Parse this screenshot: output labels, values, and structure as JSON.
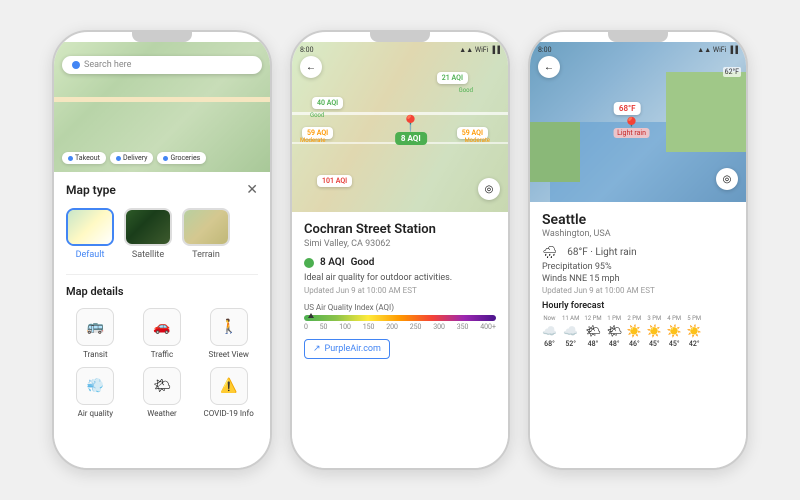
{
  "phones": [
    {
      "id": "phone1",
      "statusbar": {
        "time": "",
        "signal": ""
      },
      "map": {
        "search_placeholder": "Search here"
      },
      "chips": [
        "Takeout",
        "Delivery",
        "Groceries"
      ],
      "panel": {
        "title": "Map type",
        "types": [
          {
            "id": "default",
            "label": "Default",
            "active": true
          },
          {
            "id": "satellite",
            "label": "Satellite",
            "active": false
          },
          {
            "id": "terrain",
            "label": "Terrain",
            "active": false
          }
        ],
        "details_title": "Map details",
        "details": [
          {
            "id": "transit",
            "label": "Transit",
            "icon": "🚌"
          },
          {
            "id": "traffic",
            "label": "Traffic",
            "icon": "🚗"
          },
          {
            "id": "street_view",
            "label": "Street View",
            "icon": "🚶"
          },
          {
            "id": "air_quality",
            "label": "Air quality",
            "icon": "💨"
          },
          {
            "id": "weather",
            "label": "Weather",
            "icon": "🌤"
          },
          {
            "id": "covid",
            "label": "COVID-19 Info",
            "icon": "⚠️"
          }
        ]
      }
    },
    {
      "id": "phone2",
      "statusbar": {
        "time": "8:00"
      },
      "aqi_badges": [
        {
          "value": "21 AQI",
          "class": "aqi-21",
          "label": "Good"
        },
        {
          "value": "40 AQI",
          "class": "aqi-40",
          "label": "Good"
        },
        {
          "value": "59 AQI",
          "class": "aqi-59a",
          "label": "Moderate"
        },
        {
          "value": "59 AQI",
          "class": "aqi-59b",
          "label": "Moderate"
        },
        {
          "value": "101 AQI",
          "class": "aqi-101",
          "label": ""
        }
      ],
      "location": {
        "name": "Cochran Street Station",
        "address": "Simi Valley, CA 93062",
        "aqi_value": "8 AQI",
        "aqi_quality": "Good",
        "description": "Ideal air quality for outdoor activities.",
        "updated": "Updated Jun 9 at 10:00 AM EST",
        "bar_title": "US Air Quality Index (AQI)",
        "bar_numbers": [
          "0",
          "50",
          "100",
          "150",
          "200",
          "250",
          "300",
          "350",
          "400+"
        ],
        "source_link": "PurpleAir.com"
      }
    },
    {
      "id": "phone3",
      "statusbar": {
        "time": "8:00"
      },
      "temp_labels": [
        "62°F",
        ""
      ],
      "weather_badge": "68°F",
      "location": {
        "city": "Seattle",
        "state": "Washington, USA",
        "temp": "68°F",
        "condition": "Light rain",
        "precipitation": "Precipitation 95%",
        "winds": "Winds NNE 15 mph",
        "updated": "Updated Jun 9 at 10:00 AM EST",
        "hourly_label": "Hourly forecast"
      },
      "hourly": [
        {
          "time": "Now",
          "icon": "☁️",
          "temp": "68°"
        },
        {
          "time": "11 AM",
          "icon": "☁️",
          "temp": "52°"
        },
        {
          "time": "12 PM",
          "icon": "🌤",
          "temp": "48°"
        },
        {
          "time": "1 PM",
          "icon": "🌤",
          "temp": "48°"
        },
        {
          "time": "2 PM",
          "icon": "☀️",
          "temp": "46°"
        },
        {
          "time": "3 PM",
          "icon": "☀️",
          "temp": "45°"
        },
        {
          "time": "4 PM",
          "icon": "☀️",
          "temp": "45°"
        },
        {
          "time": "5 PM",
          "icon": "☀️",
          "temp": "42°"
        }
      ]
    }
  ]
}
